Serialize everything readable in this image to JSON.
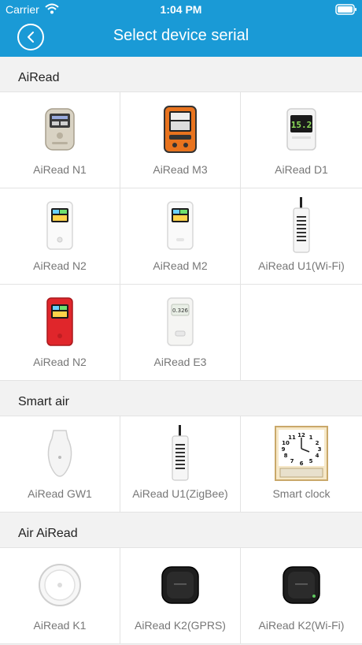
{
  "status_bar": {
    "carrier": "Carrier",
    "time": "1:04 PM",
    "wifi_icon": "wifi-icon",
    "battery_icon": "battery-icon"
  },
  "nav": {
    "title": "Select device serial",
    "back_icon": "chevron-left-icon"
  },
  "sections": [
    {
      "title": "AiRead",
      "devices": [
        {
          "label": "AiRead N1",
          "icon": "airead-n1-device"
        },
        {
          "label": "AiRead M3",
          "icon": "airead-m3-device"
        },
        {
          "label": "AiRead D1",
          "icon": "airead-d1-device"
        },
        {
          "label": "AiRead N2",
          "icon": "airead-n2-white-device"
        },
        {
          "label": "AiRead M2",
          "icon": "airead-m2-device"
        },
        {
          "label": "AiRead U1(Wi-Fi)",
          "icon": "airead-u1-wifi-device"
        },
        {
          "label": "AiRead N2",
          "icon": "airead-n2-red-device"
        },
        {
          "label": "AiRead E3",
          "icon": "airead-e3-device"
        }
      ]
    },
    {
      "title": "Smart air",
      "devices": [
        {
          "label": "AiRead GW1",
          "icon": "airead-gw1-device"
        },
        {
          "label": "AiRead U1(ZigBee)",
          "icon": "airead-u1-zigbee-device"
        },
        {
          "label": "Smart clock",
          "icon": "smart-clock-device"
        }
      ]
    },
    {
      "title": "Air AiRead",
      "devices": [
        {
          "label": "AiRead K1",
          "icon": "airead-k1-device"
        },
        {
          "label": "AiRead K2(GPRS)",
          "icon": "airead-k2-gprs-device"
        },
        {
          "label": "AiRead K2(Wi-Fi)",
          "icon": "airead-k2-wifi-device"
        }
      ]
    }
  ],
  "device_screen_texts": {
    "d1_reading": "15.2",
    "e3_reading": "0.326",
    "clock_numerals": [
      "12",
      "1",
      "2",
      "3",
      "4",
      "5",
      "6",
      "7",
      "8",
      "9",
      "10",
      "11"
    ]
  }
}
